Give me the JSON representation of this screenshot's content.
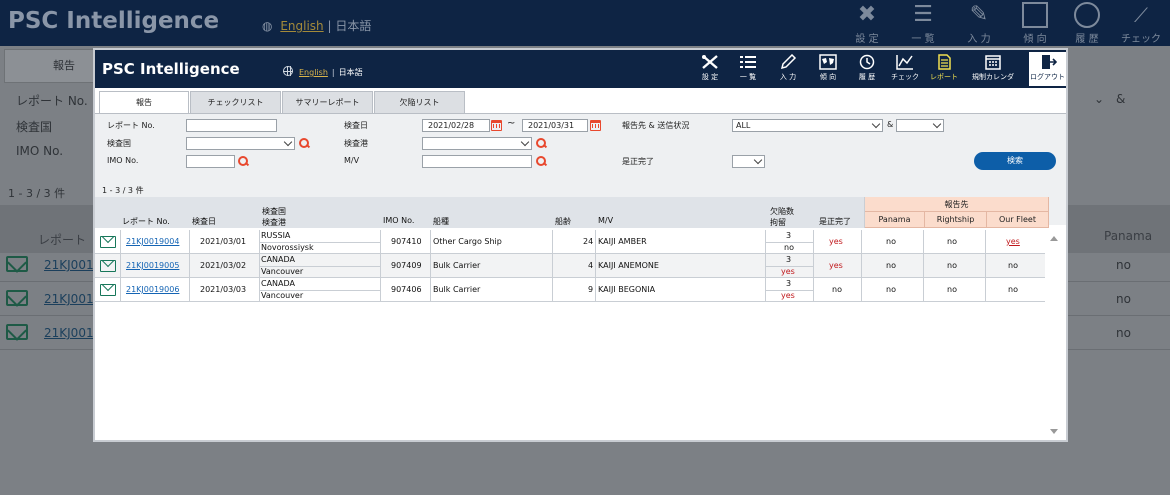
{
  "app": {
    "title": "PSC Intelligence",
    "lang_en": "English",
    "lang_sep": "|",
    "lang_ja": "日本語"
  },
  "nav": [
    {
      "label": "設 定",
      "icon": "settings-tools-icon"
    },
    {
      "label": "一 覧",
      "icon": "list-icon"
    },
    {
      "label": "入 力",
      "icon": "pencil-icon"
    },
    {
      "label": "傾 向",
      "icon": "world-map-icon"
    },
    {
      "label": "履 歴",
      "icon": "clock-icon"
    },
    {
      "label": "チェック",
      "icon": "line-chart-icon"
    },
    {
      "label": "レポート",
      "icon": "document-icon"
    },
    {
      "label": "規制カレンダ",
      "icon": "calendar-icon"
    },
    {
      "label": "ログアウト",
      "icon": "logout-icon"
    }
  ],
  "tabs": [
    "報告",
    "チェックリスト",
    "サマリーレポート",
    "欠陥リスト"
  ],
  "search": {
    "report_no_label": "レポート No.",
    "report_no_value": "",
    "insp_date_label": "検査日",
    "date_from": "2021/02/28",
    "date_sep": "~",
    "date_to": "2021/03/31",
    "report_to_label": "報告先 & 送信状況",
    "report_to_value": "ALL",
    "amp": "&",
    "status_value": "",
    "country_label": "検査国",
    "country_value": "",
    "port_label": "検査港",
    "port_value": "",
    "imo_label": "IMO No.",
    "imo_value": "",
    "mv_label": "M/V",
    "mv_value": "",
    "rect_label": "是正完了",
    "rect_value": "",
    "search_button": "検索"
  },
  "result_count": "1 - 3 / 3 件",
  "table": {
    "headers": {
      "report_no": "レポート No.",
      "insp_date": "検査日",
      "country": "検査国",
      "port": "検査港",
      "imo": "IMO No.",
      "ship_type": "船種",
      "age": "船齢",
      "mv": "M/V",
      "defects": "欠陥数",
      "detention": "拘留",
      "rectified": "是正完了",
      "report_to": "報告先",
      "panama": "Panama",
      "rightship": "Rightship",
      "our_fleet": "Our Fleet"
    },
    "rows": [
      {
        "report_no": "21KJ0019004",
        "date": "2021/03/01",
        "country": "RUSSIA",
        "port": "Novorossiysk",
        "imo": "907410",
        "ship_type": "Other Cargo Ship",
        "age": "24",
        "mv": "KAIJI AMBER",
        "defects": "3",
        "detention": "no",
        "rectified": "yes",
        "panama": "no",
        "rightship": "no",
        "our_fleet": "yes"
      },
      {
        "report_no": "21KJ0019005",
        "date": "2021/03/02",
        "country": "CANADA",
        "port": "Vancouver",
        "imo": "907409",
        "ship_type": "Bulk Carrier",
        "age": "4",
        "mv": "KAIJI ANEMONE",
        "defects": "3",
        "detention": "yes",
        "rectified": "yes",
        "panama": "no",
        "rightship": "no",
        "our_fleet": "no"
      },
      {
        "report_no": "21KJ0019006",
        "date": "2021/03/03",
        "country": "CANADA",
        "port": "Vancouver",
        "imo": "907406",
        "ship_type": "Bulk Carrier",
        "age": "9",
        "mv": "KAIJI BEGONIA",
        "defects": "3",
        "detention": "yes",
        "rectified": "no",
        "panama": "no",
        "rightship": "no",
        "our_fleet": "no"
      }
    ]
  },
  "background": {
    "title": "PSC Intelligence",
    "lang_en": "English",
    "lang_ja": "| 日本語",
    "nav": [
      "設 定",
      "一 覧",
      "入 力",
      "傾 向",
      "履 歴",
      "チェック"
    ],
    "tab": "報告",
    "labels": [
      "レポート No.",
      "検査国",
      "IMO No."
    ],
    "amp": "&",
    "count": "1 - 3 / 3 件",
    "col_report": "レポート",
    "col_panama": "Panama",
    "ids": [
      "21KJ001",
      "21KJ001",
      "21KJ001"
    ],
    "vals": [
      "no",
      "no",
      "no"
    ]
  },
  "colors": {
    "navy": "#0e2444",
    "accent_button": "#0d5ea8",
    "red": "#c0181c",
    "link": "#1464b4",
    "mail": "#17775a",
    "peach": "#fbdccc"
  }
}
